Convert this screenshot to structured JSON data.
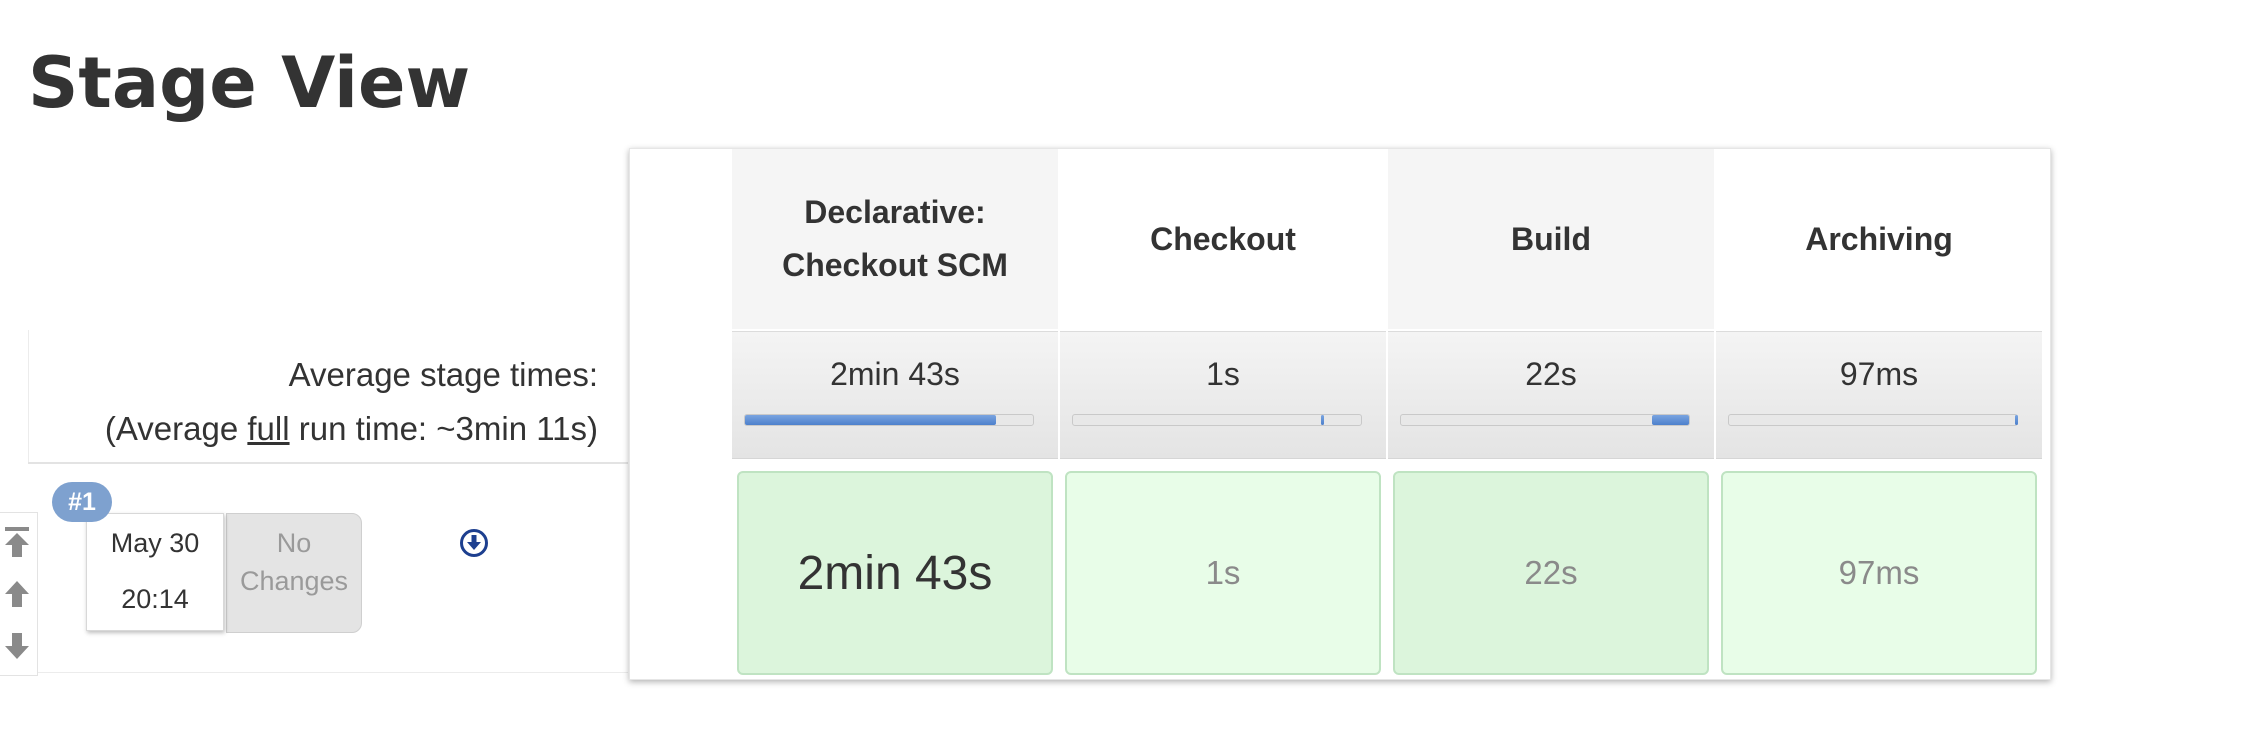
{
  "page": {
    "title": "Stage View"
  },
  "summary": {
    "avg_stage_times_label": "Average stage times:",
    "avg_full_prefix": "(Average ",
    "avg_full_link": "full",
    "avg_full_suffix": " run time: ~3min 11s)"
  },
  "build": {
    "badge": "#1",
    "date": "May 30",
    "time": "20:14",
    "changes_line1": "No",
    "changes_line2": "Changes"
  },
  "stages": [
    {
      "name_line1": "Declarative:",
      "name_line2": "Checkout SCM",
      "avg": "2min 43s",
      "bar_start": 0,
      "bar_end": 0.87,
      "cell": "2min 43s"
    },
    {
      "name_line1": "Checkout",
      "name_line2": "",
      "avg": "1s",
      "bar_start": 0.86,
      "bar_end": 0.87,
      "cell": "1s"
    },
    {
      "name_line1": "Build",
      "name_line2": "",
      "avg": "22s",
      "bar_start": 0.87,
      "bar_end": 1.0,
      "cell": "22s"
    },
    {
      "name_line1": "Archiving",
      "name_line2": "",
      "avg": "97ms",
      "bar_start": 0.994,
      "bar_end": 1.0,
      "cell": "97ms"
    }
  ],
  "colors": {
    "success_cell_dark": "#dcf5dc",
    "success_cell_light": "#e8fde8",
    "badge": "#7ea1cf",
    "bar_fill": "#5b8dd6"
  },
  "icons": {
    "scroll_top": "arrow-to-top-icon",
    "scroll_up": "arrow-up-icon",
    "scroll_down": "arrow-down-icon",
    "download": "download-circle-icon"
  }
}
